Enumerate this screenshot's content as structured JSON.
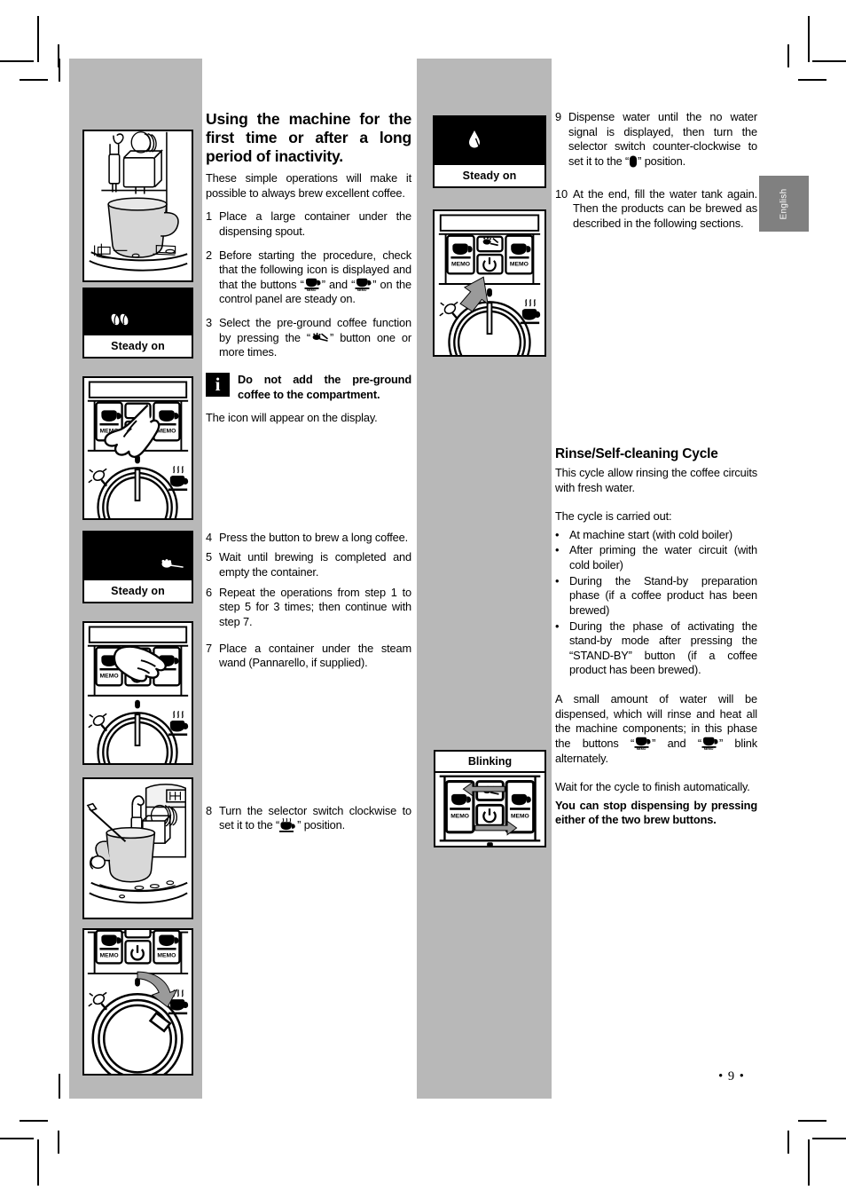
{
  "page": {
    "number": "• 9 •",
    "language_tab": "English"
  },
  "left_column": {
    "heading": "Using the machine for the first time or after a long period of inactivity.",
    "intro": "These simple operations will make it possible to always brew excellent coffee.",
    "steps": [
      {
        "num": "1",
        "text": "Place a large container under the dispensing spout."
      },
      {
        "num": "2",
        "text_before": "Before starting the procedure, check that the following icon is displayed and that the buttons “",
        "text_mid": "” and “",
        "text_after": "” on the control panel are steady on."
      },
      {
        "num": "3",
        "text_before": "Select the pre-ground coffee function by pressing the “",
        "text_after": "” button one or more times."
      },
      {
        "num": "4",
        "text": "Press the button to brew a long coffee."
      },
      {
        "num": "5",
        "text": "Wait until brewing is completed and empty the container."
      },
      {
        "num": "6",
        "text": "Repeat the operations from step 1 to step 5 for 3 times; then continue with step 7."
      },
      {
        "num": "7",
        "text": "Place a container under the steam wand (Pannarello, if supplied)."
      },
      {
        "num": "8",
        "text_before": "Turn the selector switch clockwise to set it to the “",
        "text_after": "” position."
      }
    ],
    "note": {
      "icon": "info-icon",
      "text": "Do not add the pre-ground coffee to the compartment."
    },
    "after_note": "The icon will appear on the display."
  },
  "right_column": {
    "steps": [
      {
        "num": "9",
        "text_before": "Dispense water until the no water signal is displayed, then turn the selector switch counter-clockwise to set it to the “",
        "text_after": "” position."
      },
      {
        "num": "10",
        "text": "At the end, fill the water tank again. Then the products can be brewed as described in the following sections."
      }
    ],
    "rinse": {
      "heading": "Rinse/Self-cleaning Cycle",
      "intro": "This cycle allow rinsing the coffee circuits with fresh water.",
      "list_intro": "The cycle is carried out:",
      "bullets": [
        "At machine start (with cold boiler)",
        "After priming the water circuit (with cold boiler)",
        "During the Stand-by preparation phase (if a coffee product has been brewed)",
        "During the phase of activating the stand-by mode after pressing the “STAND-BY” button (if a coffee product has been brewed)."
      ],
      "para_before_icons": "A small amount of water will be dispensed, which will rinse and heat all the machine components; in this phase the buttons “",
      "para_mid_icons": "” and “",
      "para_after_icons": "” blink alternately.",
      "closing_normal": "Wait for the cycle to finish automatically.",
      "closing_bold": "You can stop dispensing by pressing either of the two brew buttons."
    }
  },
  "figures": {
    "left": [
      {
        "name": "machine-cup-dispensing",
        "type": "illustration"
      },
      {
        "name": "display-coffee-bean",
        "type": "lcd",
        "caption": "Steady on",
        "icon": "coffee-beans-icon"
      },
      {
        "name": "control-panel-hand-press-preground",
        "type": "illustration"
      },
      {
        "name": "display-preground-icon",
        "type": "lcd",
        "caption": "Steady on",
        "icon": "pre-ground-coffee-icon"
      },
      {
        "name": "control-panel-hand-press-long-coffee",
        "type": "illustration"
      },
      {
        "name": "machine-steam-wand-container",
        "type": "illustration"
      },
      {
        "name": "control-panel-selector-clockwise",
        "type": "illustration"
      }
    ],
    "middle": [
      {
        "name": "display-no-water-icon",
        "type": "lcd",
        "caption": "Steady on",
        "icon": "no-water-icon"
      },
      {
        "name": "control-panel-selector-counter-clockwise",
        "type": "illustration"
      },
      {
        "name": "control-panel-blinking-buttons",
        "type": "illustration",
        "caption": "Blinking"
      }
    ]
  },
  "colors": {
    "column_background": "#b8b8b8",
    "tab_background": "#808080",
    "ink": "#000000",
    "paper": "#ffffff"
  }
}
